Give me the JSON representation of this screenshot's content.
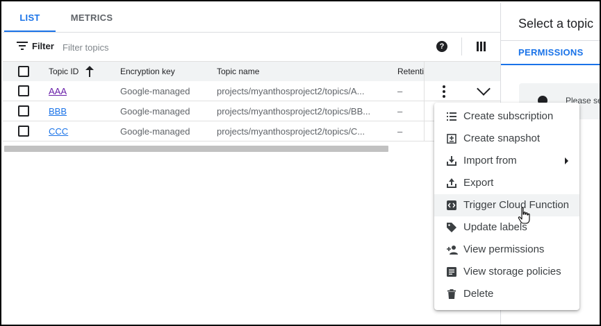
{
  "tabs": [
    {
      "label": "LIST",
      "active": true
    },
    {
      "label": "METRICS",
      "active": false
    }
  ],
  "toolbar": {
    "filter_label": "Filter",
    "filter_placeholder": "Filter topics",
    "help_glyph": "?"
  },
  "table": {
    "columns": [
      "Topic ID",
      "Encryption key",
      "Topic name",
      "Retenti"
    ],
    "sort": {
      "column": "Topic ID",
      "direction": "ascending"
    },
    "rows": [
      {
        "topic_id": "AAA",
        "encryption": "Google-managed",
        "topic_name": "projects/myanthosproject2/topics/A...",
        "retention": "–",
        "visited": true
      },
      {
        "topic_id": "BBB",
        "encryption": "Google-managed",
        "topic_name": "projects/myanthosproject2/topics/BB...",
        "retention": "–",
        "visited": false
      },
      {
        "topic_id": "CCC",
        "encryption": "Google-managed",
        "topic_name": "projects/myanthosproject2/topics/C...",
        "retention": "–",
        "visited": false
      }
    ]
  },
  "right_panel": {
    "title": "Select a topic",
    "tab": "PERMISSIONS",
    "notice": "Please se"
  },
  "menu": {
    "items": [
      {
        "label": "Create subscription",
        "icon": "list-icon"
      },
      {
        "label": "Create snapshot",
        "icon": "snapshot-icon"
      },
      {
        "label": "Import from",
        "icon": "import-icon",
        "has_submenu": true
      },
      {
        "label": "Export",
        "icon": "export-icon"
      },
      {
        "label": "Trigger Cloud Function",
        "icon": "code-icon",
        "hover": true
      },
      {
        "label": "Update labels",
        "icon": "label-icon"
      },
      {
        "label": "View permissions",
        "icon": "person-add-icon"
      },
      {
        "label": "View storage policies",
        "icon": "document-icon"
      },
      {
        "label": "Delete",
        "icon": "trash-icon"
      }
    ]
  },
  "colors": {
    "accent": "#1a73e8",
    "visited_link": "#681da8",
    "header_bg": "#f1f3f4",
    "menu_hover": "#f1f3f4"
  }
}
